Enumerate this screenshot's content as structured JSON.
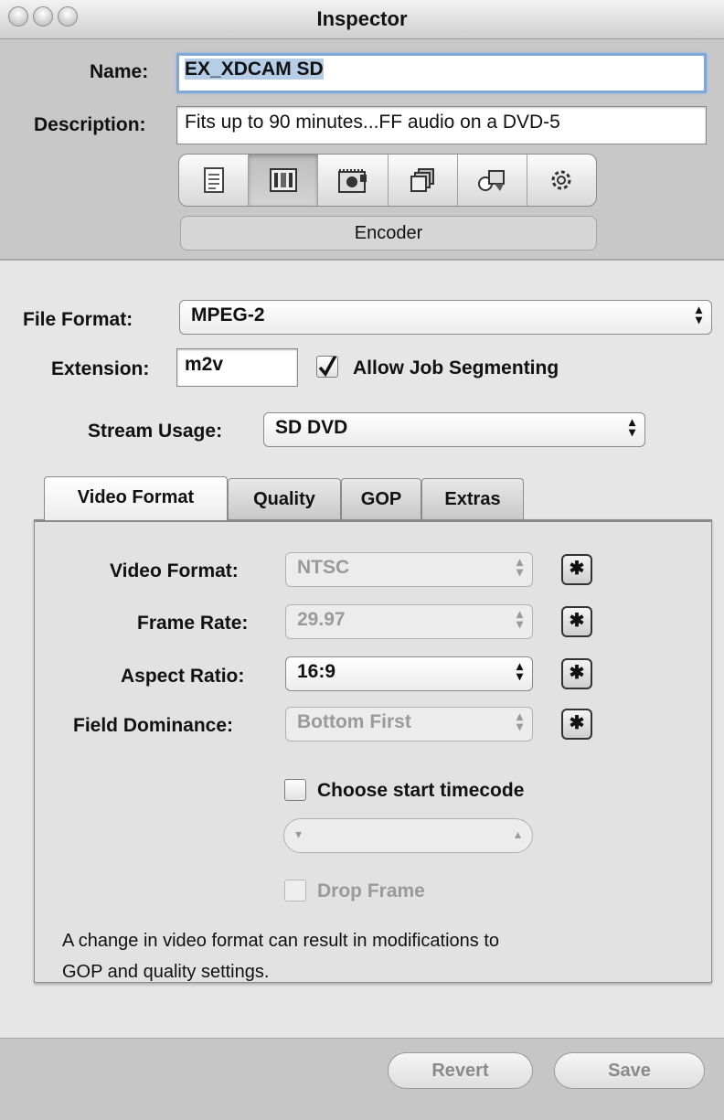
{
  "window": {
    "title": "Inspector"
  },
  "header": {
    "name_label": "Name:",
    "name_value": "EX_XDCAM SD",
    "description_label": "Description:",
    "description_value": "Fits up to 90 minutes...FF audio on a DVD-5",
    "toolbar_icons": [
      "summary-icon",
      "encoder-icon",
      "frame-controls-icon",
      "filters-icon",
      "geometry-icon",
      "actions-icon"
    ],
    "active_pane": "Encoder"
  },
  "encoder": {
    "file_format_label": "File Format:",
    "file_format_value": "MPEG-2",
    "extension_label": "Extension:",
    "extension_value": "m2v",
    "allow_job_segmenting_label": "Allow Job Segmenting",
    "allow_job_segmenting_checked": true,
    "stream_usage_label": "Stream Usage:",
    "stream_usage_value": "SD DVD"
  },
  "tabs": [
    {
      "label": "Video Format",
      "active": true
    },
    {
      "label": "Quality",
      "active": false
    },
    {
      "label": "GOP",
      "active": false
    },
    {
      "label": "Extras",
      "active": false
    }
  ],
  "video_format": {
    "video_format_label": "Video Format:",
    "video_format_value": "NTSC",
    "frame_rate_label": "Frame Rate:",
    "frame_rate_value": "29.97",
    "aspect_ratio_label": "Aspect Ratio:",
    "aspect_ratio_value": "16:9",
    "field_dominance_label": "Field Dominance:",
    "field_dominance_value": "Bottom First",
    "choose_start_timecode_label": "Choose start timecode",
    "choose_start_timecode_checked": false,
    "drop_frame_label": "Drop Frame",
    "drop_frame_checked": false,
    "note_line1": "A change in video format can result in modifications to",
    "note_line2": "GOP and quality settings."
  },
  "footer": {
    "revert_label": "Revert",
    "save_label": "Save"
  }
}
